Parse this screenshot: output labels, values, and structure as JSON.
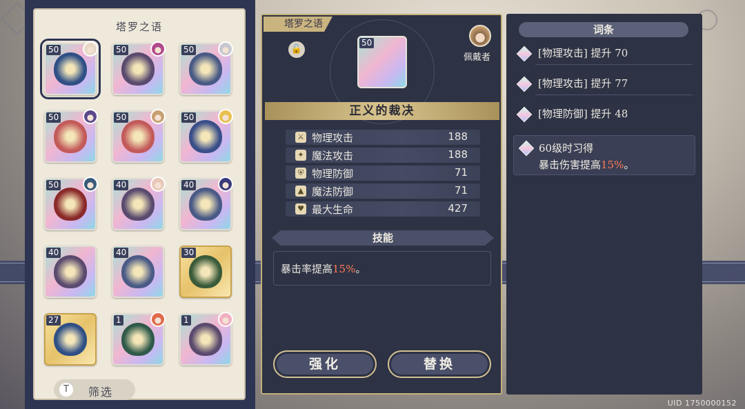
{
  "inventory": {
    "title": "塔罗之语",
    "filter_label": "筛选",
    "filter_icon": "T",
    "cards": [
      {
        "level": "50",
        "style": "normal",
        "art": "#2f4f86",
        "owner": "#e8d8c6",
        "selected": true
      },
      {
        "level": "50",
        "style": "normal",
        "art": "#5a4a6e",
        "owner": "#b04a8a"
      },
      {
        "level": "50",
        "style": "normal",
        "art": "#4a5a86",
        "owner": "#c7c7d0"
      },
      {
        "level": "50",
        "style": "normal",
        "art": "#c25a5a",
        "owner": "#5a4a8a"
      },
      {
        "level": "50",
        "style": "normal",
        "art": "#c25a5a",
        "owner": "#c8a070"
      },
      {
        "level": "50",
        "style": "normal",
        "art": "#3a4f8a",
        "owner": "#e8c050"
      },
      {
        "level": "50",
        "style": "normal",
        "art": "#8a2a2a",
        "owner": "#3a5a7a"
      },
      {
        "level": "40",
        "style": "normal",
        "art": "#5a4a6e",
        "owner": "#e8c8b8"
      },
      {
        "level": "40",
        "style": "normal",
        "art": "#4a5a86",
        "owner": "#3a3a7a"
      },
      {
        "level": "40",
        "style": "normal",
        "art": "#5a4a6e",
        "owner": null
      },
      {
        "level": "40",
        "style": "normal",
        "art": "#4a5a86",
        "owner": null
      },
      {
        "level": "30",
        "style": "gold",
        "art": "#3a5a3a",
        "owner": null
      },
      {
        "level": "27",
        "style": "gold",
        "art": "#2f4f86",
        "owner": null
      },
      {
        "level": "1",
        "style": "normal",
        "art": "#2f5a4a",
        "owner": "#e06a4a"
      },
      {
        "level": "1",
        "style": "normal",
        "art": "#5a4a6e",
        "owner": "#f0b0c0"
      }
    ]
  },
  "detail": {
    "tag": "塔罗之语",
    "lock_icon": "🔓",
    "card_level": "50",
    "wearer_label": "佩戴者",
    "name": "正义的裁决",
    "stats": [
      {
        "icon": "sword-icon",
        "glyph": "⚔",
        "name": "物理攻击",
        "value": "188"
      },
      {
        "icon": "staff-icon",
        "glyph": "✦",
        "name": "魔法攻击",
        "value": "188"
      },
      {
        "icon": "shield-icon",
        "glyph": "⛨",
        "name": "物理防御",
        "value": "71"
      },
      {
        "icon": "hat-icon",
        "glyph": "▲",
        "name": "魔法防御",
        "value": "71"
      },
      {
        "icon": "heart-icon",
        "glyph": "♥",
        "name": "最大生命",
        "value": "427"
      }
    ],
    "skill_header": "技能",
    "skill_text_prefix": "暴击率提高",
    "skill_text_value": "15%",
    "skill_text_suffix": "。",
    "enhance_label": "强化",
    "replace_label": "替换"
  },
  "traits": {
    "header": "词条",
    "items": [
      {
        "text": "[物理攻击] 提升 70"
      },
      {
        "text": "[物理攻击] 提升 77"
      },
      {
        "text": "[物理防御] 提升 48"
      }
    ],
    "unlock_title": "60级时习得",
    "unlock_prefix": "暴击伤害提高",
    "unlock_value": "15%",
    "unlock_suffix": "。"
  },
  "footer": {
    "uid": "UID 1750000152"
  }
}
